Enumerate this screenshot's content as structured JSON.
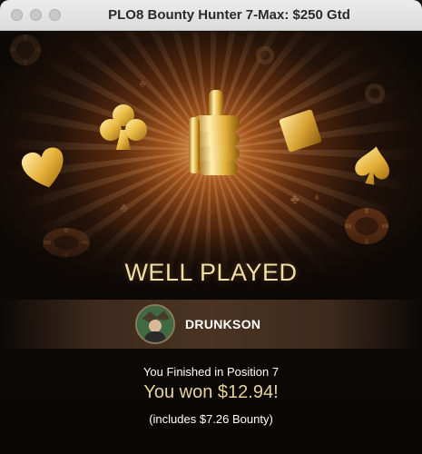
{
  "window": {
    "title": "PLO8 Bounty Hunter 7-Max: $250 Gtd",
    "controls": [
      "close-button",
      "minimize-button",
      "zoom-button"
    ]
  },
  "result": {
    "headline": "WELL PLAYED",
    "player_name": "DRUNKSON",
    "position_text": "You Finished in Position 7",
    "won_text": "You won $12.94!",
    "bounty_text": "(includes $7.26 Bounty)"
  },
  "icons": {
    "trophy": "thumbs-up-trophy-icon",
    "suits": [
      "club-icon",
      "heart-icon",
      "diamond-icon",
      "spade-icon"
    ],
    "chips": "poker-chip-icon",
    "avatar": "player-avatar"
  },
  "colors": {
    "gold": "#e8c46a",
    "headline": "#f1dda7",
    "won_text": "#e7d29a",
    "glow": "#e8a760",
    "background": "#0d0906"
  }
}
